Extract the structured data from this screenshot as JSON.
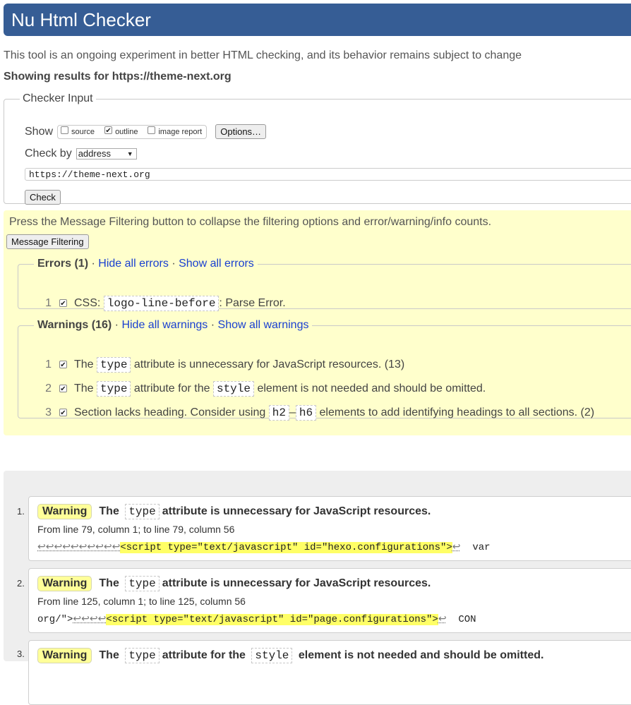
{
  "header": {
    "title": "Nu Html Checker"
  },
  "intro": "This tool is an ongoing experiment in better HTML checking, and its behavior remains subject to change",
  "results_for": "Showing results for https://theme-next.org",
  "checker_input": {
    "legend": "Checker Input",
    "show_label": "Show",
    "options": [
      {
        "label": "source",
        "checked": false
      },
      {
        "label": "outline",
        "checked": true
      },
      {
        "label": "image report",
        "checked": false
      }
    ],
    "options_button": "Options…",
    "check_by_label": "Check by",
    "check_by_value": "address",
    "url": "https://theme-next.org",
    "check_button": "Check"
  },
  "filter": {
    "note": "Press the Message Filtering button to collapse the filtering options and error/warning/info counts.",
    "button": "Message Filtering",
    "errors": {
      "title": "Errors (1)",
      "hide": "Hide all errors",
      "show": "Show all errors",
      "items": [
        {
          "num": "1",
          "pre": "CSS: ",
          "code": "logo-line-before",
          "post": ": Parse Error."
        }
      ]
    },
    "warnings": {
      "title": "Warnings (16)",
      "hide": "Hide all warnings",
      "show": "Show all warnings",
      "items": [
        {
          "num": "1",
          "pre": "The",
          "code": "type",
          "post": "attribute is unnecessary for JavaScript resources. (13)"
        },
        {
          "num": "2",
          "pre": "The",
          "code": "type",
          "mid": "attribute for the",
          "code2": "style",
          "post": "element is not needed and should be omitted."
        },
        {
          "num": "3",
          "pre": "Section lacks heading. Consider using",
          "code": "h2",
          "dash": "–",
          "code2": "h6",
          "post": "elements to add identifying headings to all sections. (2)"
        }
      ]
    }
  },
  "results": [
    {
      "num": "1.",
      "badge": "Warning",
      "pre": "The",
      "code": "type",
      "post": "attribute is unnecessary for JavaScript resources.",
      "location": "From line 79, column 1; to line 79, column 56",
      "ext_before": "↩↩↩↩↩↩↩↩↩↩",
      "ext_hl": "<script type=\"text/javascript\" id=\"hexo.configurations\">",
      "ext_ret": "↩",
      "ext_after": "  var"
    },
    {
      "num": "2.",
      "badge": "Warning",
      "pre": "The",
      "code": "type",
      "post": "attribute is unnecessary for JavaScript resources.",
      "location": "From line 125, column 1; to line 125, column 56",
      "ext_plain": "org/\">",
      "ext_before": "↩↩↩↩",
      "ext_hl": "<script type=\"text/javascript\" id=\"page.configurations\">",
      "ext_ret": "↩",
      "ext_after": "  CON"
    },
    {
      "num": "3.",
      "badge": "Warning",
      "pre": "The",
      "code": "type",
      "post": "attribute for the",
      "code2": "style",
      "post2": "element is not needed and should be omitted."
    }
  ]
}
